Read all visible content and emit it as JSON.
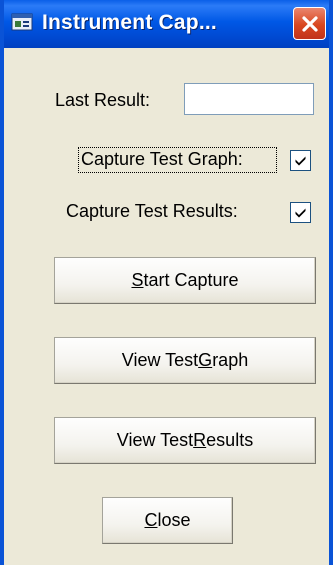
{
  "window": {
    "title": "Instrument Cap..."
  },
  "fields": {
    "last_result_label": "Last Result:",
    "last_result_value": ""
  },
  "options": {
    "capture_graph_label": "Capture Test Graph:",
    "capture_graph_checked": true,
    "capture_results_label": "Capture Test Results:",
    "capture_results_checked": true
  },
  "buttons": {
    "start": {
      "pre": "",
      "key": "S",
      "post": "tart Capture"
    },
    "view_graph": {
      "pre": "View Test ",
      "key": "G",
      "post": "raph"
    },
    "view_results": {
      "pre": "View Test ",
      "key": "R",
      "post": "esults"
    },
    "close": {
      "pre": "",
      "key": "C",
      "post": "lose"
    }
  },
  "colors": {
    "titlebar": "#0058e6",
    "window_bg": "#ece9d8",
    "close_button": "#d9471f"
  }
}
